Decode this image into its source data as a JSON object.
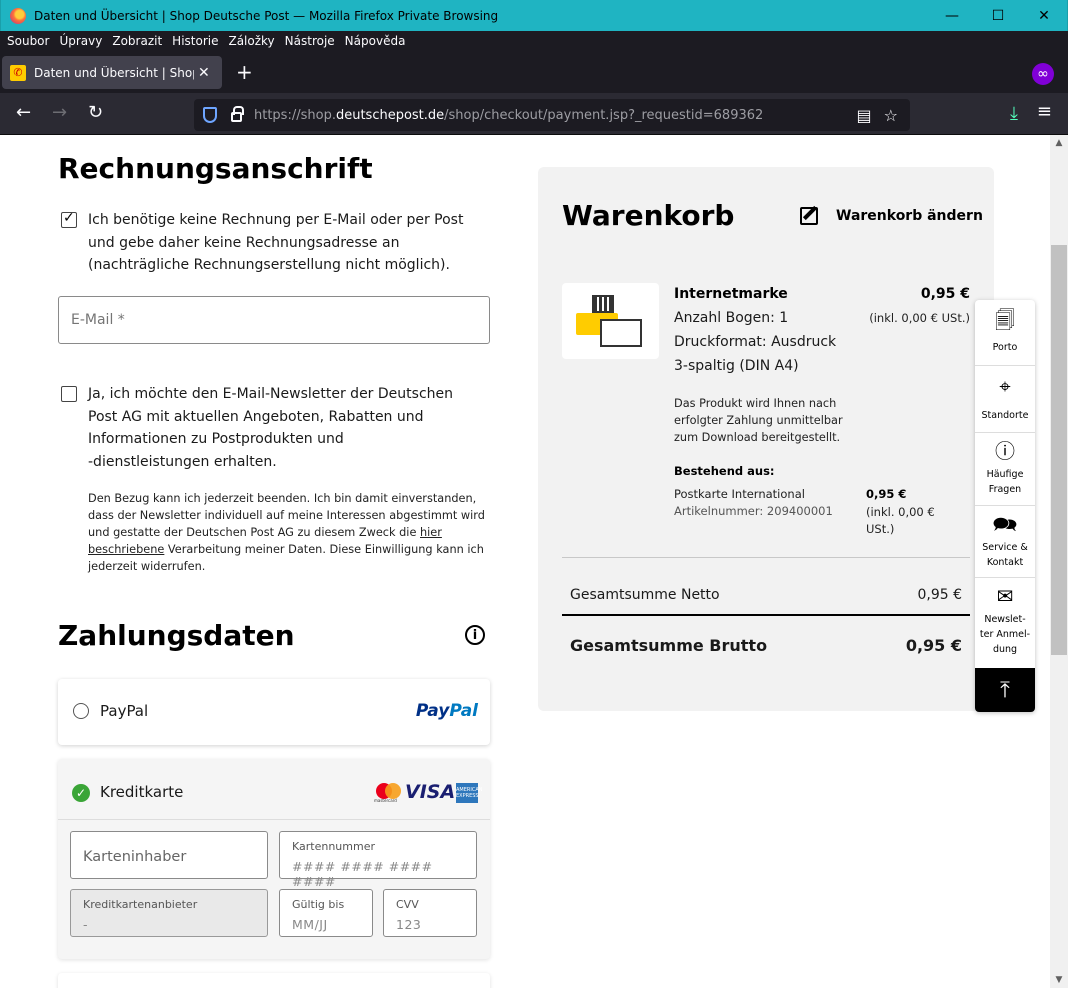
{
  "window": {
    "title": "Daten und Übersicht | Shop Deutsche Post — Mozilla Firefox Private Browsing"
  },
  "menu": [
    "Soubor",
    "Úpravy",
    "Zobrazit",
    "Historie",
    "Záložky",
    "Nástroje",
    "Nápověda"
  ],
  "tab": {
    "title": "Daten und Übersicht | Shop Deutsche Post",
    "favicon_glyph": "📯"
  },
  "url": {
    "prefix": "https://shop.",
    "domain": "deutschepost.de",
    "path": "/shop/checkout/payment.jsp?_requestid=689362"
  },
  "billing": {
    "heading": "Rechnungsanschrift",
    "no_invoice_label": "Ich benötige keine Rechnung per E-Mail oder per Post und gebe daher keine Rechnungsadresse an (nachträgliche Rechnungserstellung nicht möglich).",
    "no_invoice_line1": "Ich benötige keine Rechnung per E-Mail oder per Post",
    "no_invoice_line2": "und gebe daher keine Rechnungsadresse an",
    "no_invoice_line3": "(nachträgliche Rechnungserstellung nicht möglich).",
    "email_placeholder": "E-Mail *",
    "newsletter_line1": "Ja, ich möchte den E-Mail-Newsletter der Deutschen",
    "newsletter_line2": "Post AG mit aktuellen Angeboten, Rabatten und",
    "newsletter_line3": "Informationen zu Postprodukten und",
    "newsletter_line4": "-dienstleistungen erhalten.",
    "legal_part1": "Den Bezug kann ich jederzeit beenden. Ich bin damit einverstanden, dass der Newsletter individuell auf meine Interessen abgestimmt wird und gestatte der Deutschen Post AG zu diesem Zweck die ",
    "legal_link": "hier beschriebene",
    "legal_part2": " Verarbeitung meiner Daten. Diese Einwilligung kann ich jederzeit widerrufen."
  },
  "payment": {
    "heading": "Zahlungsdaten",
    "paypal_label": "PayPal",
    "paypal_logo_1": "Pay",
    "paypal_logo_2": "Pal",
    "cc_label": "Kreditkarte",
    "visa_logo": "VISA",
    "mastercard_text": "mastercard",
    "amex_text": "AMERICAN EXPRESS",
    "card_holder_placeholder": "Karteninhaber",
    "card_number_label": "Kartennummer",
    "card_number_placeholder": "#### #### #### ####",
    "provider_label": "Kreditkartenanbieter",
    "provider_value": "-",
    "valid_label": "Gültig bis",
    "valid_placeholder": "MM/JJ",
    "cvv_label": "CVV",
    "cvv_placeholder": "123"
  },
  "cart": {
    "title": "Warenkorb",
    "edit_label": "Warenkorb ändern",
    "product_name": "Internetmarke",
    "product_price": "0,95 €",
    "product_tax": "(inkl. 0,00 € USt.)",
    "sheets": "Anzahl Bogen:  1",
    "format_line1": "Druckformat:  Ausdruck",
    "format_line2": "3-spaltig (DIN A4)",
    "note": "Das Produkt wird Ihnen nach erfolgter Zahlung unmittelbar zum Download bereitgestellt.",
    "consists_of": "Bestehend aus:",
    "sub_name": "Postkarte International",
    "sub_article": "Artikelnummer: 209400001",
    "sub_price": "0,95 €",
    "sub_tax": "(inkl. 0,00 € USt.)",
    "net_label": "Gesamtsumme Netto",
    "net_value": "0,95 €",
    "gross_label": "Gesamtsumme Brutto",
    "gross_value": "0,95 €"
  },
  "side_widget": {
    "porto": "Porto",
    "standorte": "Standorte",
    "faq_1": "Häufige",
    "faq_2": "Fragen",
    "service_1": "Service &",
    "service_2": "Kontakt",
    "news_1": "Newslet-",
    "news_2": "ter Anmel-",
    "news_3": "dung"
  }
}
